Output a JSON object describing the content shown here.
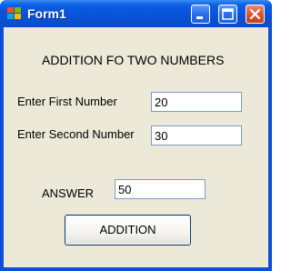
{
  "window": {
    "title": "Form1",
    "icon": "windows-form-icon",
    "controls": [
      "minimize-icon",
      "maximize-icon",
      "close-icon"
    ]
  },
  "form": {
    "heading": "ADDITION FO TWO NUMBERS",
    "first_label": "Enter First Number",
    "first_value": "20",
    "second_label": "Enter Second Number",
    "second_value": "30",
    "answer_label": "ANSWER",
    "answer_value": "50",
    "addition_button": "ADDITION"
  },
  "colors": {
    "titlebar": "#0852d9",
    "client_background": "#ece9d8",
    "textbox_border": "#7f9db9",
    "close_button": "#d9532b"
  }
}
